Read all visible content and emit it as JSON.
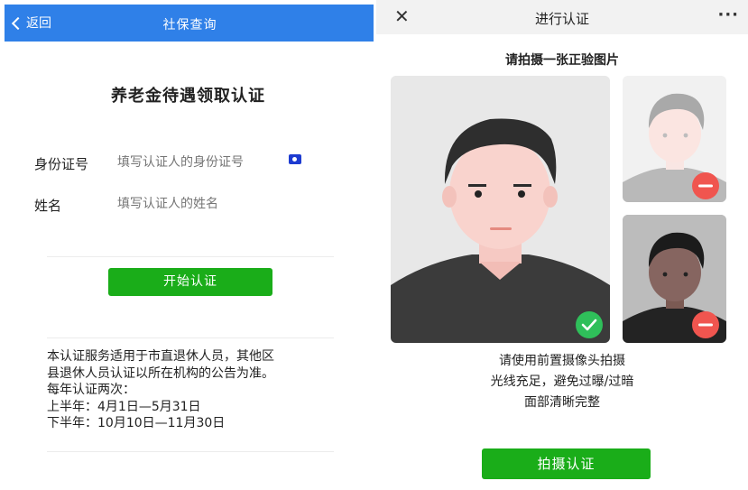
{
  "left": {
    "header": {
      "back_label": "返回",
      "title": "社保查询"
    },
    "form_title": "养老金待遇领取认证",
    "id_field": {
      "label": "身份证号",
      "placeholder": "填写认证人的身份证号"
    },
    "name_field": {
      "label": "姓名",
      "placeholder": "填写认证人的姓名"
    },
    "start_button": "开始认证",
    "notice": [
      "本认证服务适用于市直退休人员，其他区",
      "县退休人员认证以所在机构的公告为准。",
      "每年认证两次：",
      "上半年：4月1日—5月31日",
      "下半年：10月10日—11月30日"
    ]
  },
  "right": {
    "header": {
      "close_label": "✕",
      "title": "进行认证",
      "more_label": "···"
    },
    "prompt": "请拍摄一张正验图片",
    "hints": [
      "请使用前置摄像头拍摄",
      "光线充足，避免过曝/过暗",
      "面部清晰完整"
    ],
    "capture_button": "拍摄认证"
  },
  "colors": {
    "header_blue": "#2f80e8",
    "button_green": "#1aad19",
    "ok_green": "#2fbf5a",
    "bad_red": "#f0554f"
  },
  "icons": [
    "chevron-left-icon",
    "camera-icon",
    "close-icon",
    "more-icon",
    "check-icon",
    "minus-icon"
  ]
}
